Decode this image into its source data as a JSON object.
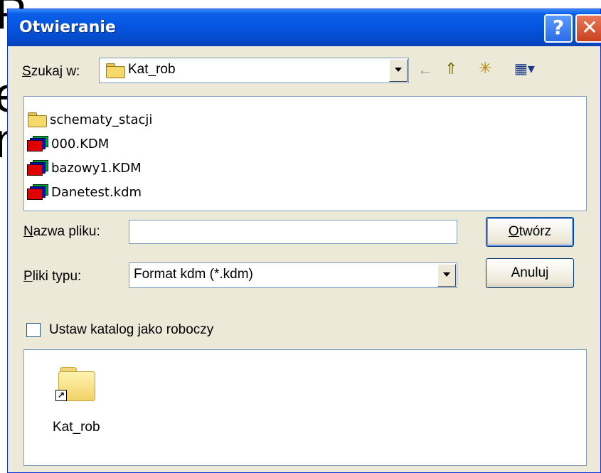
{
  "window": {
    "title": "Otwieranie",
    "help_label": "?",
    "close_label": "✕"
  },
  "look_in": {
    "label_underlined": "S",
    "label_rest": "zukaj w:",
    "value": "Kat_rob"
  },
  "toolbar": {
    "back_icon": "←",
    "up_icon": "⇑",
    "new_folder_icon": "✳",
    "views_icon": "▦▾"
  },
  "files": [
    {
      "name": "schematy_stacji",
      "type": "folder"
    },
    {
      "name": "000.KDM",
      "type": "kdm"
    },
    {
      "name": "bazowy1.KDM",
      "type": "kdm"
    },
    {
      "name": "Danetest.kdm",
      "type": "kdm"
    }
  ],
  "filename": {
    "label_underlined": "N",
    "label_rest": "azwa pliku:",
    "value": ""
  },
  "filetype": {
    "label_underlined": "P",
    "label_rest": "liki typu:",
    "value": "Format kdm (*.kdm)"
  },
  "buttons": {
    "open_underlined": "O",
    "open_rest": "twórz",
    "cancel": "Anuluj"
  },
  "checkbox": {
    "label": "Ustaw katalog jako roboczy",
    "checked": false
  },
  "places": {
    "item_label": "Kat_rob",
    "shortcut_glyph": "↗"
  }
}
